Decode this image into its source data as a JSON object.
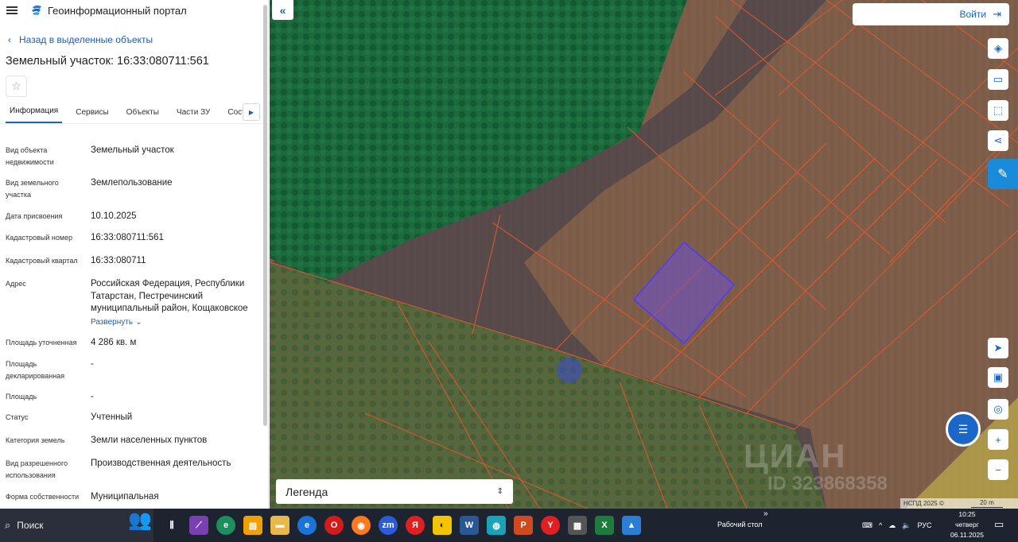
{
  "header": {
    "portal_title": "Геоинформационный портал"
  },
  "nav": {
    "back_label": "Назад в выделенные объекты"
  },
  "object": {
    "title": "Земельный участок: 16:33:080711:561"
  },
  "tabs": [
    "Информация",
    "Сервисы",
    "Объекты",
    "Части ЗУ",
    "Соста"
  ],
  "properties": [
    {
      "key": "Вид объекта недвижимости",
      "value": "Земельный участок"
    },
    {
      "key": "Вид земельного участка",
      "value": "Землепользование"
    },
    {
      "key": "Дата присвоения",
      "value": "10.10.2025"
    },
    {
      "key": "Кадастровый номер",
      "value": "16:33:080711:561"
    },
    {
      "key": "Кадастровый квартал",
      "value": "16:33:080711"
    },
    {
      "key": "Адрес",
      "value": "Российская Федерация, Республики Татарстан, Пестречинский муниципальный район, Кощаковское"
    },
    {
      "key": "Площадь уточненная",
      "value": "4 286 кв. м"
    },
    {
      "key": "Площадь декларированная",
      "value": "-"
    },
    {
      "key": "Площадь",
      "value": "-"
    },
    {
      "key": "Статус",
      "value": "Учтенный"
    },
    {
      "key": "Категория земель",
      "value": "Земли населенных пунктов"
    },
    {
      "key": "Вид разрешенного использования",
      "value": "Производственная деятельность"
    },
    {
      "key": "Форма собственности",
      "value": "Муниципальная"
    }
  ],
  "expand_label": "Развернуть",
  "map": {
    "login_label": "Войти",
    "legend_label": "Легенда",
    "copyright": "НСПД 2025 ©",
    "scale_label": "20 m",
    "watermark": "ЦИАН",
    "watermark_id": "ID 323868358",
    "colors": {
      "parcel_fill": "#6f52c8",
      "parcel_border": "#4d3bff",
      "boundary": "#e0582e",
      "forest": "#1a6a3c"
    }
  },
  "taskbar": {
    "search_label": "Поиск",
    "desktop_label": "Рабочий стол",
    "language": "РУС",
    "time": "10:25",
    "weekday": "четверг",
    "date": "06.11.2025"
  }
}
